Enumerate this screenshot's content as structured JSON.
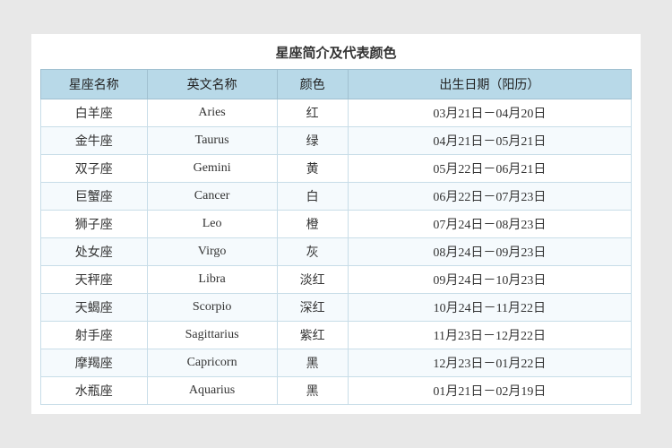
{
  "title": "星座简介及代表颜色",
  "headers": {
    "col1": "星座名称",
    "col2": "英文名称",
    "col3": "颜色",
    "col4": "出生日期（阳历）"
  },
  "rows": [
    {
      "zh": "白羊座",
      "en": "Aries",
      "color": "红",
      "date": "03月21日－04月20日"
    },
    {
      "zh": "金牛座",
      "en": "Taurus",
      "color": "绿",
      "date": "04月21日－05月21日"
    },
    {
      "zh": "双子座",
      "en": "Gemini",
      "color": "黄",
      "date": "05月22日－06月21日"
    },
    {
      "zh": "巨蟹座",
      "en": "Cancer",
      "color": "白",
      "date": "06月22日－07月23日"
    },
    {
      "zh": "狮子座",
      "en": "Leo",
      "color": "橙",
      "date": "07月24日－08月23日"
    },
    {
      "zh": "处女座",
      "en": "Virgo",
      "color": "灰",
      "date": "08月24日－09月23日"
    },
    {
      "zh": "天秤座",
      "en": "Libra",
      "color": "淡红",
      "date": "09月24日－10月23日"
    },
    {
      "zh": "天蝎座",
      "en": "Scorpio",
      "color": "深红",
      "date": "10月24日－11月22日"
    },
    {
      "zh": "射手座",
      "en": "Sagittarius",
      "color": "紫红",
      "date": "11月23日－12月22日"
    },
    {
      "zh": "摩羯座",
      "en": "Capricorn",
      "color": "黑",
      "date": "12月23日－01月22日"
    },
    {
      "zh": "水瓶座",
      "en": "Aquarius",
      "color": "黑",
      "date": "01月21日－02月19日"
    }
  ]
}
